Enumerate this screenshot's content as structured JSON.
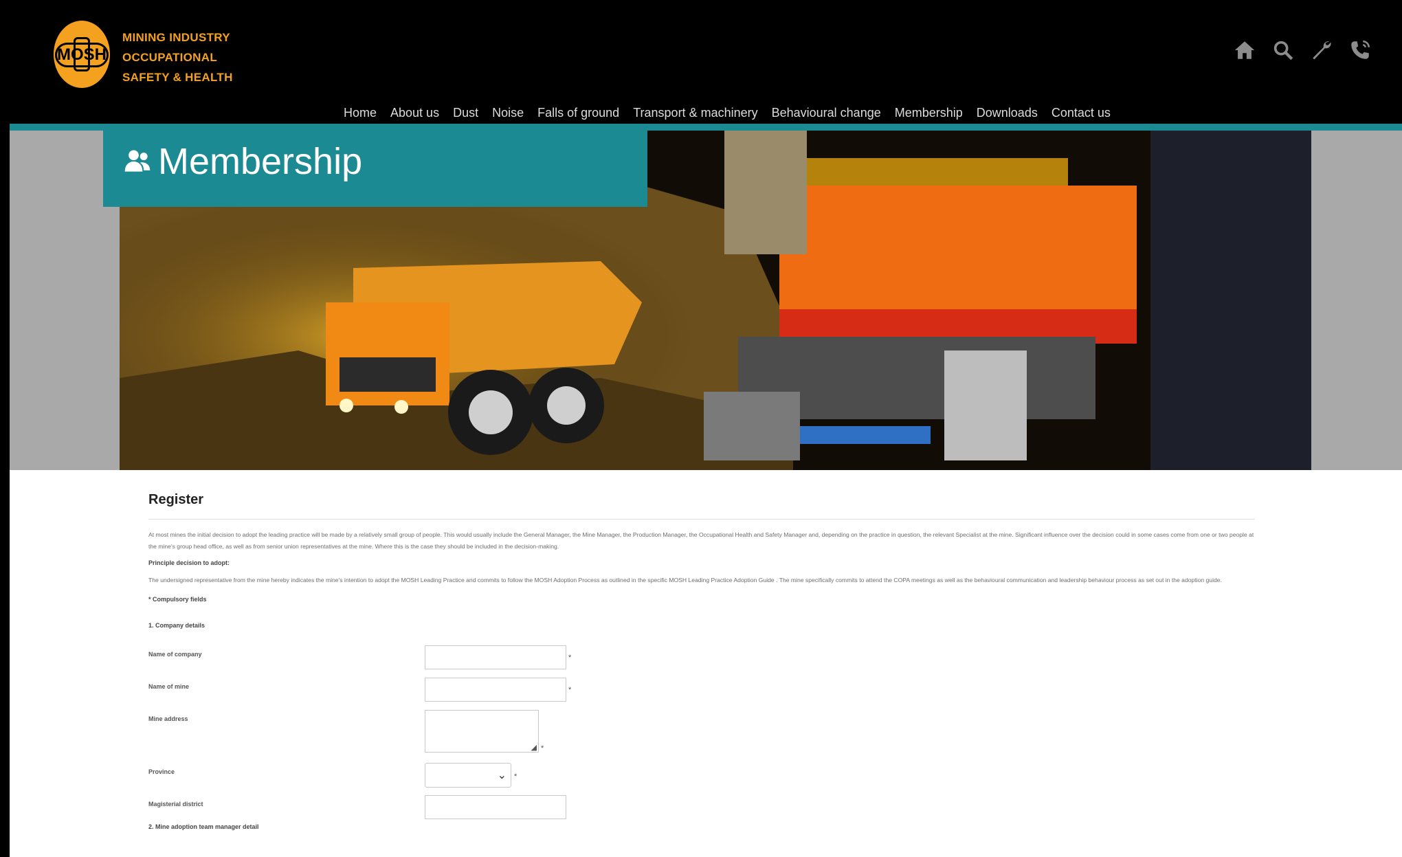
{
  "brand": {
    "logo_text": "MOSH",
    "lines": [
      "MINING INDUSTRY",
      "OCCUPATIONAL",
      "SAFETY & HEALTH"
    ]
  },
  "top_icons": [
    "home-icon",
    "search-icon",
    "wrench-icon",
    "phone-icon"
  ],
  "nav": [
    "Home",
    "About us",
    "Dust",
    "Noise",
    "Falls of ground",
    "Transport & machinery",
    "Behavioural change",
    "Membership",
    "Downloads",
    "Contact us"
  ],
  "banner": {
    "title": "Membership"
  },
  "colors": {
    "teal": "#1c8a93",
    "orange": "#f3a11f",
    "header_bg": "#000000"
  },
  "form": {
    "title": "Register",
    "intro": "At most mines the initial decision to adopt the leading practice will be made by a relatively small group of people. This would usually include the General Manager, the Mine Manager, the Production Manager, the Occupational Health and Safety Manager and, depending on the practice in question, the relevant Specialist at the mine. Significant influence over the decision could in some cases come from one or two people at the mine's group head office, as well as from senior union representatives at the mine. Where this is the case they should be included in the decision-making.",
    "principle_heading": "Principle decision to adopt:",
    "principle_text": "The undersigned representative from the mine hereby indicates the mine's intention to adopt the MOSH Leading Practice and commits to follow the MOSH Adoption Process as outlined in the specific MOSH Leading Practice Adoption Guide . The mine specifically commits to attend the COPA meetings as well as the behavioural communication and leadership behaviour process as set out in the adoption guide.",
    "compulsory_note": "* Compulsory fields",
    "section1": "1. Company details",
    "fields": [
      {
        "label": "Name of company",
        "required_mark": "*"
      },
      {
        "label": "Name of mine",
        "required_mark": "*"
      },
      {
        "label": "Mine address",
        "required_mark": "*"
      },
      {
        "label": "Province",
        "required_mark": "*"
      },
      {
        "label": "Magisterial district",
        "required_mark": ""
      }
    ],
    "section2": "2. Mine adoption team manager detail"
  }
}
